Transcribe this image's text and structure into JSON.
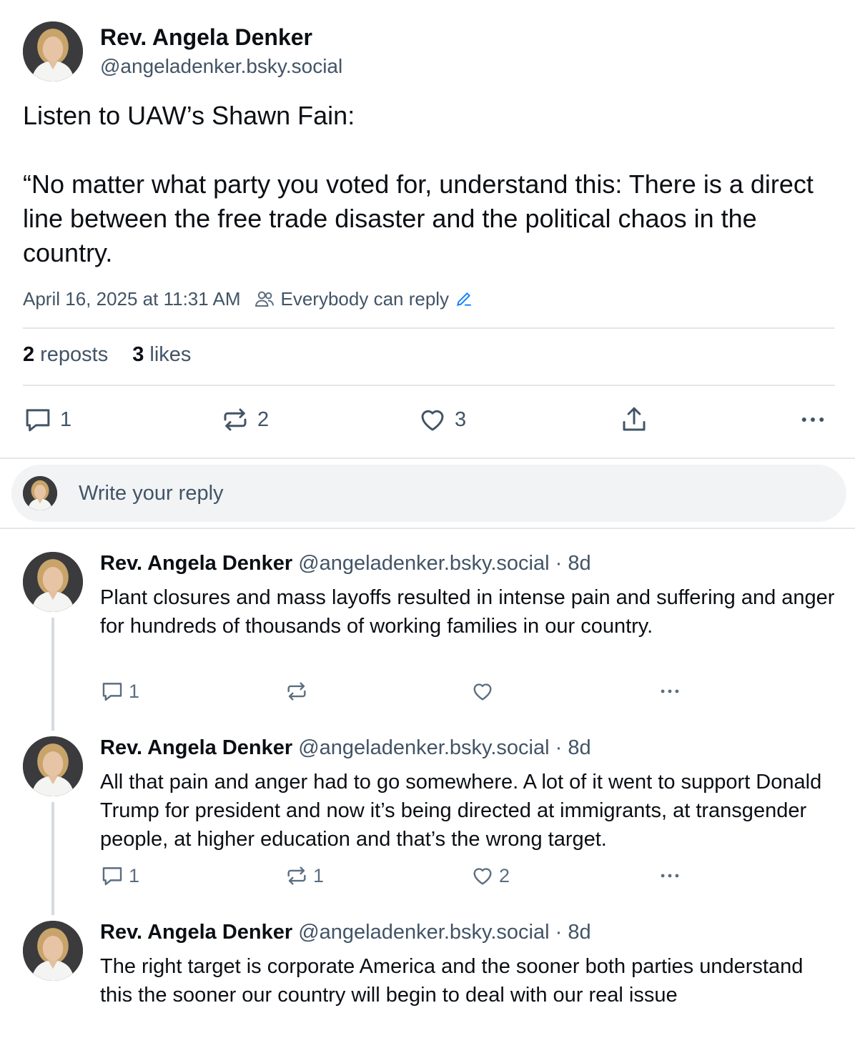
{
  "post": {
    "author_name": "Rev. Angela Denker",
    "author_handle": "@angeladenker.bsky.social",
    "text": "Listen to UAW’s Shawn Fain:\n\n“No matter what party you voted for, understand this: There is a direct line between the free trade disaster and the political chaos in the country.",
    "timestamp": "April 16, 2025 at 11:31 AM",
    "reply_setting": "Everybody can reply",
    "reposts_count": "2",
    "reposts_label": "reposts",
    "likes_count": "3",
    "likes_label": "likes",
    "actions": {
      "reply_count": "1",
      "repost_count": "2",
      "like_count": "3"
    }
  },
  "composer": {
    "placeholder": "Write your reply"
  },
  "replies": [
    {
      "author_name": "Rev. Angela Denker",
      "author_handle": "@angeladenker.bsky.social · 8d",
      "text": "Plant closures and mass layoffs resulted in intense pain and suffering and anger for hundreds of thousands of working families in our country.",
      "reply_count": "1",
      "repost_count": "",
      "like_count": ""
    },
    {
      "author_name": "Rev. Angela Denker",
      "author_handle": "@angeladenker.bsky.social · 8d",
      "text": "All that pain and anger had to go somewhere. A lot of it went to support Donald Trump for president and now it’s being directed at immigrants, at transgender people, at higher education and that’s the wrong target.",
      "reply_count": "1",
      "repost_count": "1",
      "like_count": "2"
    },
    {
      "author_name": "Rev. Angela Denker",
      "author_handle": "@angeladenker.bsky.social · 8d",
      "text": "The right target is corporate America and the sooner both parties understand this the sooner our country will begin to deal with our real issue"
    }
  ],
  "colors": {
    "text": "#0b0f14",
    "muted": "#425466",
    "accent": "#1083fe",
    "divider": "#e3e7eb",
    "composer_bg": "#f1f3f5"
  },
  "icons": [
    "people-icon",
    "edit-icon",
    "reply-icon",
    "repost-icon",
    "like-icon",
    "share-icon",
    "more-icon"
  ]
}
